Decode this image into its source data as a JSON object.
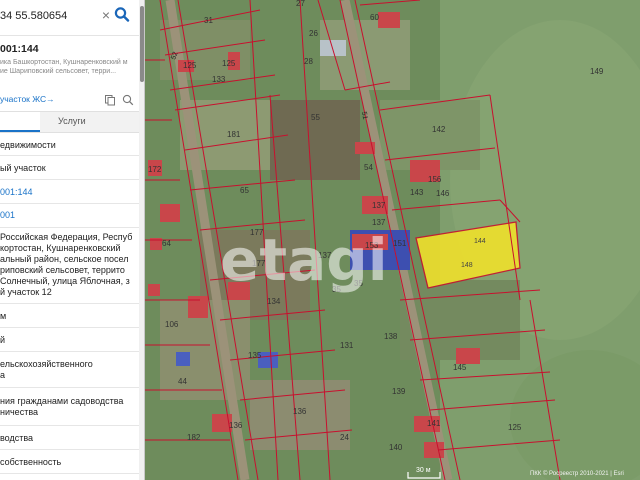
{
  "search": {
    "value": "34 55.580654",
    "clear_symbol": "×",
    "search_icon": "search-icon"
  },
  "object": {
    "number": "001:144",
    "address_lines": [
      "ика Башкортостан, Кушнаренковский м",
      "ие Шариповский сельсовет, терри..."
    ],
    "link_text": "участок ЖС→",
    "icons": [
      "copy-icon",
      "pin-icon"
    ]
  },
  "tabs": {
    "services_label": "Услуги"
  },
  "rows": [
    {
      "lines": [
        "едвижимости"
      ]
    },
    {
      "lines": [
        "ый участок"
      ]
    },
    {
      "lines": [
        "001:144"
      ],
      "link": true
    },
    {
      "lines": [
        "001"
      ],
      "link": true
    },
    {
      "lines": [
        "Российская Федерация, Респуб",
        "кортостан, Кушнаренковский",
        "альный район, сельское посел",
        "риповский сельсовет, террито",
        "Солнечный, улица Яблочная, з",
        "й участок 12"
      ]
    },
    {
      "lines": [
        "м"
      ]
    },
    {
      "lines": [
        "й"
      ]
    },
    {
      "lines": [
        "ельскохозяйственного",
        "а"
      ]
    },
    {
      "lines": [
        "ния гражданами садоводства",
        "ничества"
      ]
    },
    {
      "lines": [
        "водства"
      ]
    },
    {
      "lines": [
        "собственность"
      ]
    }
  ],
  "map": {
    "plot_numbers": [
      "31",
      "27",
      "26",
      "60",
      "149",
      "133",
      "28",
      "125",
      "125",
      "55",
      "142",
      "181",
      "54",
      "172",
      "65",
      "143",
      "156",
      "146",
      "137",
      "137",
      "64",
      "177",
      "153",
      "151",
      "144",
      "148",
      "177",
      "137",
      "35",
      "35",
      "134",
      "106",
      "138",
      "131",
      "44",
      "145",
      "135",
      "139",
      "136",
      "182",
      "136",
      "141",
      "140",
      "24",
      "125"
    ],
    "street_labels": [
      "51",
      "52"
    ],
    "highlight_plot_label_top": "144",
    "highlight_plot_label_bottom": "148",
    "watermark": "etagi",
    "scale_text": "30 м",
    "copyright": "ПКК © Росреестр 2010-2021 | Esri"
  },
  "colors": {
    "highlight_fill": "#f2e22a",
    "parcel_border": "#c8102e",
    "link_blue": "#1a73c8"
  }
}
